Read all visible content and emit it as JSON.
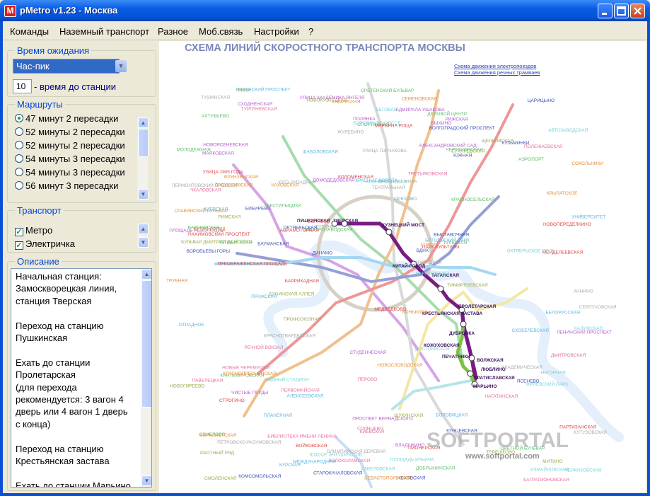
{
  "window": {
    "title": "pMetro v1.23 - Москва",
    "icon": "metro-logo-icon",
    "icon_letter": "M"
  },
  "menu": [
    "Команды",
    "Наземный транспорт",
    "Разное",
    "Моб.связь",
    "Настройки",
    "?"
  ],
  "wait": {
    "title": "Время ожидания",
    "selected": "Час-пик",
    "minutes": "10",
    "minutes_label": "- время до станции"
  },
  "routes": {
    "title": "Маршруты",
    "items": [
      {
        "label": "47 минут 2 пересадки",
        "selected": true
      },
      {
        "label": "52 минуты 2 пересадки",
        "selected": false
      },
      {
        "label": "52 минуты 2 пересадки",
        "selected": false
      },
      {
        "label": "54 минуты 3 пересадки",
        "selected": false
      },
      {
        "label": "54 минуты 3 пересадки",
        "selected": false
      },
      {
        "label": "56 минут 3 пересадки",
        "selected": false
      }
    ]
  },
  "transport": {
    "title": "Транспорт",
    "items": [
      {
        "label": "Метро",
        "checked": true
      },
      {
        "label": "Электричка",
        "checked": true
      }
    ]
  },
  "description": {
    "title": "Описание",
    "text": "Начальная станция:\nЗамоскворецкая линия,\nстанция Тверская\n\nПереход на станцию\nПушкинская\n\nЕхать до станции\nПролетарская\n(для перехода\nрекомендуется: 3 вагон 4\nдверь или 4 вагон 1 дверь\nс конца)\n\nПереход на станцию\nКрестьянская застава\n\nЕхать до станции Марьино"
  },
  "map": {
    "title": "СХЕМА ЛИНИЙ СКОРОСТНОГО ТРАНСПОРТА МОСКВЫ",
    "link1": "Схема движения электропоездов",
    "link2": "Схема движения речных трамваев",
    "watermark": "SOFTPORTAL",
    "watermark_url": "www.softportal.com",
    "route_labels": [
      "ПУШКИНСКАЯ",
      "ТВЕРСКАЯ",
      "КУЗНЕЦКИЙ МОСТ",
      "КИТАЙ-ГОРОД",
      "ТАГАНСКАЯ",
      "ПРОЛЕТАРСКАЯ",
      "КРЕСТЬЯНСКАЯ ЗАСТАВА",
      "ДУБРОВКА",
      "КОЖУХОВСКАЯ",
      "ПЕЧАТНИКИ",
      "ВОЛЖСКАЯ",
      "ЛЮБЛИНО",
      "БРАТИСЛАВСКАЯ",
      "МАРЬИНО"
    ],
    "other_labels": [
      "МЕДВЕДКОВО",
      "БАБУШКИНСКАЯ",
      "СВИБЛОВО",
      "ВДНХ",
      "АЛЕКСЕЕВСКАЯ",
      "РИЖСКАЯ",
      "ПРОСПЕКТ МИРА",
      "СУХАРЕВСКАЯ",
      "ТУРГЕНЕВСКАЯ",
      "ЧЕРКИЗОВСКАЯ",
      "ПРЕОБРАЖЕНСКАЯ ПЛОЩАДЬ",
      "СОКОЛЬНИКИ",
      "КРАСНОСЕЛЬСКАЯ",
      "КОМСОМОЛЬСКАЯ",
      "КРАСНЫЕ ВОРОТА",
      "ЧИСТЫЕ ПРУДЫ",
      "ЛУБЯНКА",
      "ОХОТНЫЙ РЯД",
      "БИБЛИОТЕКА ИМЕНИ ЛЕНИНА",
      "КРОПОТКИНСКАЯ",
      "ПАРК КУЛЬТУРЫ",
      "ФРУНЗЕНСКАЯ",
      "СПОРТИВНАЯ",
      "ВОРОБЬЕВЫ ГОРЫ",
      "УНИВЕРСИТЕТ",
      "ПРОСПЕКТ ВЕРНАДСКОГО",
      "ЮГО-ЗАПАДНАЯ",
      "ЩЕЛКОВСКАЯ",
      "ПЕРВОМАЙСКАЯ",
      "ИЗМАЙЛОВСКАЯ",
      "ПАРТИЗАНСКАЯ",
      "СЕМЕНОВСКАЯ",
      "ЭЛЕКТРОЗАВОДСКАЯ",
      "БАУМАНСКАЯ",
      "КУРСКАЯ",
      "ПЛОЩАДЬ РЕВОЛЮЦИИ",
      "АРБАТСКАЯ",
      "СМОЛЕНСКАЯ",
      "КИЕВСКАЯ",
      "ПАРК ПОБЕДЫ",
      "СТРОГИНО",
      "КРЫЛАТСКОЕ",
      "МОЛОДЕЖНАЯ",
      "КУНЦЕВСКАЯ",
      "ПЛАНЕРНАЯ",
      "СХОДНЕНСКАЯ",
      "ТУШИНСКАЯ",
      "ЩУКИНСКАЯ",
      "ПОЛЕЖАЕВСКАЯ",
      "БЕГОВАЯ",
      "БАРРИКАДНАЯ",
      "КИТАЙ-ГОРОД",
      "ТЕКСТИЛЬЩИКИ",
      "КУЗЬМИНКИ",
      "РЯЗАНСКИЙ ПРОСПЕКТ",
      "ВЫХИНО",
      "ЖУЛЕБИНО",
      "НОВОГИРЕЕВО",
      "ПЕРОВО",
      "ШОССЕ ЭНТУЗИАСТОВ",
      "АВИАМОТОРНАЯ",
      "МАРКСИСТСКАЯ",
      "АЛТУФЬЕВО",
      "БИБИРЕВО",
      "ОТРАДНОЕ",
      "ВЛАДЫКИНО",
      "ПЕТРОВСКО-РАЗУМОВСКАЯ",
      "ТИМИРЯЗЕВСКАЯ",
      "ДМИТРОВСКАЯ",
      "САВЕЛОВСКАЯ",
      "МЕНДЕЛЕЕВСКАЯ",
      "НОВОСЛОБОДСКАЯ",
      "ЦВЕТНОЙ БУЛЬВАР",
      "ЧЕХОВСКАЯ",
      "БОРОВИЦКАЯ",
      "ПОЛЯНКА",
      "СЕРПУХОВСКАЯ",
      "ТУЛЬСКАЯ",
      "НАГАТИНСКАЯ",
      "НАГОРНАЯ",
      "НАХИМОВСКИЙ ПРОСПЕКТ",
      "СЕВАСТОПОЛЬСКАЯ",
      "ЧЕРТАНОВСКАЯ",
      "ЮЖНАЯ",
      "ПРАЖСКАЯ",
      "УЛИЦА АКАДЕМИКА ЯНГЕЛЯ",
      "АННИНО",
      "БУЛЬВАР ДМИТРИЯ ДОНСКОГО",
      "РЕЧНОЙ ВОКЗАЛ",
      "ВОДНЫЙ СТАДИОН",
      "ВОЙКОВСКАЯ",
      "СОКОЛ",
      "АЭРОПОРТ",
      "ДИНАМО",
      "БЕЛОРУССКАЯ",
      "МАЯКОВСКАЯ",
      "ТЕАТРАЛЬНАЯ",
      "НОВОКУЗНЕЦКАЯ",
      "ПАВЕЛЕЦКАЯ",
      "АВТОЗАВОДСКАЯ",
      "КОЛОМЕНСКАЯ",
      "КАШИРСКАЯ",
      "КАНТЕМИРОВСКАЯ",
      "ЦАРИЦЫНО",
      "ОРЕХОВО",
      "ДОМОДЕДОВСКАЯ",
      "КРАСНОГВАРДЕЙСКАЯ",
      "МИТИНО",
      "ВОЛОКОЛАМСКАЯ",
      "ОКТЯБРЬСКОЕ ПОЛЕ",
      "УЛИЦА 1905 ГОДА",
      "КРАСНОПРЕСНЕНСКАЯ",
      "ДОБРЫНИНСКАЯ",
      "ОКТЯБРЬСКАЯ",
      "ШАБОЛОВСКАЯ",
      "ЛЕНИНСКИЙ ПРОСПЕКТ",
      "АКАДЕМИЧЕСКАЯ",
      "ПРОФСОЮЗНАЯ",
      "НОВЫЕ ЧЕРЕМУШКИ",
      "КАЛУЖСКАЯ",
      "БЕЛЯЕВО",
      "КОНЬКОВО",
      "ТЕПЛЫЙ СТАН",
      "ЯСЕНЕВО",
      "БИТЦЕВСКИЙ ПАРК",
      "НОВОЯСЕНЕВСКАЯ",
      "ОЛИМПИЙСКАЯ ДЕРЕВНЯ",
      "ТЕРЕШКОВО",
      "СОЛНЦЕВО",
      "БОРОВСКОЕ ШОССЕ",
      "НОВОПЕРЕДЕЛКИНО",
      "КАХОВСКАЯ",
      "ВАРШАВСКАЯ",
      "СТАРОКАЧАЛОВСКАЯ",
      "СКОБЕЛЕВСКАЯ",
      "АДМИРАЛА УШАКОВА",
      "УЛИЦА ГОРЧАКОВА",
      "БУНИНСКАЯ АЛЛЕЯ",
      "ТРЕТЬЯКОВСКАЯ",
      "ДОСТОЕВСКАЯ",
      "МАРЬИНА РОЩА",
      "ТРУБНАЯ",
      "СРЕТЕНСКИЙ БУЛЬВАР",
      "ВОЛГОГРАДСКИЙ ПРОСПЕКТ",
      "КИЕВСКАЯ",
      "СТУДЕНЧЕСКАЯ",
      "КУТУЗОВСКАЯ",
      "ФИЛИ",
      "БАГРАТИОНОВСКАЯ",
      "ФИЛЕВСКИЙ ПАРК",
      "ПИОНЕРСКАЯ",
      "СЛАВЯНСКИЙ БУЛЬВАР",
      "ДЕЛОВОЙ ЦЕНТР",
      "ВЫСТАВОЧНАЯ",
      "МЕЖДУНАРОДНАЯ",
      "АЛЕКСАНДРОВСКИЙ САД",
      "ЛЕРМОНТОВСКИЙ ПРОСПЕКТ",
      "РИМСКАЯ",
      "ЧКАЛОВСКАЯ",
      "ПЛОЩАДЬ ИЛЬИЧА"
    ]
  }
}
